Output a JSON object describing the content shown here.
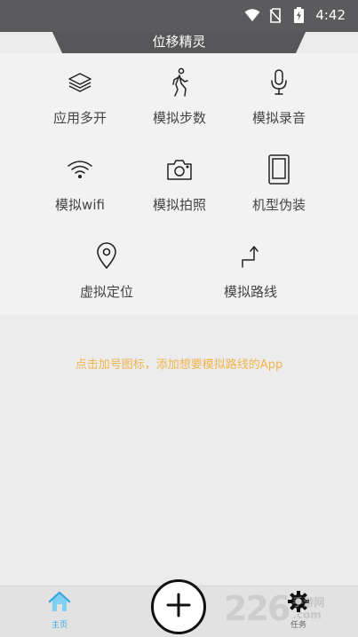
{
  "status_bar": {
    "time": "4:42",
    "icons": [
      "wifi-icon",
      "no-sim-icon",
      "battery-charging-icon"
    ]
  },
  "header": {
    "title": "位移精灵"
  },
  "features": [
    {
      "label": "应用多开",
      "icon": "layers-icon"
    },
    {
      "label": "模拟步数",
      "icon": "walking-person-icon"
    },
    {
      "label": "模拟录音",
      "icon": "microphone-icon"
    },
    {
      "label": "模拟wifi",
      "icon": "wifi-icon"
    },
    {
      "label": "模拟拍照",
      "icon": "camera-icon"
    },
    {
      "label": "机型伪装",
      "icon": "phone-icon"
    },
    {
      "label": "虚拟定位",
      "icon": "location-pin-icon"
    },
    {
      "label": "模拟路线",
      "icon": "route-icon"
    }
  ],
  "hint": "点击加号图标，添加想要模拟路线的App",
  "bottom_nav": {
    "home_label": "主页",
    "task_label": "任务",
    "add_icon": "plus-icon"
  },
  "watermark": {
    "number": "226",
    "line1": "手游网",
    "line2": ".com"
  },
  "colors": {
    "status_bar": "#5b5b5d",
    "header": "#57575a",
    "hint": "#f0b54a",
    "home_active": "#3aa9e0"
  }
}
